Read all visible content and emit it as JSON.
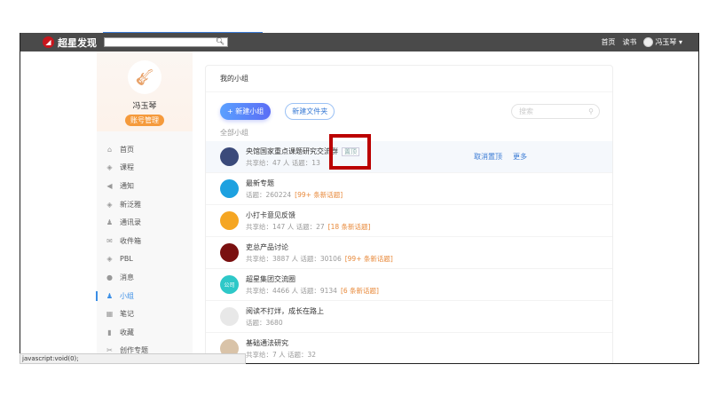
{
  "header": {
    "brand": "超星发现",
    "nav": [
      "首页",
      "读书"
    ],
    "user": "冯玉琴"
  },
  "profile": {
    "name": "冯玉琴",
    "account_button": "账号管理"
  },
  "sidebar": {
    "items": [
      {
        "label": "首页",
        "icon": "⌂"
      },
      {
        "label": "课程",
        "icon": "◈"
      },
      {
        "label": "通知",
        "icon": "◀"
      },
      {
        "label": "新泛雅",
        "icon": "◈"
      },
      {
        "label": "通讯录",
        "icon": "♟"
      },
      {
        "label": "收件箱",
        "icon": "✉"
      },
      {
        "label": "PBL",
        "icon": "◈"
      },
      {
        "label": "消息",
        "icon": "●"
      },
      {
        "label": "小组",
        "icon": "♟"
      },
      {
        "label": "笔记",
        "icon": "▦"
      },
      {
        "label": "收藏",
        "icon": "▮"
      },
      {
        "label": "创作专题",
        "icon": "✂"
      }
    ],
    "active": 8
  },
  "main": {
    "title": "我的小组",
    "new_group": "+ 新建小组",
    "new_folder": "新建文件夹",
    "search_placeholder": "搜索",
    "section": "全部小组",
    "groups": [
      {
        "name": "央馆国家重点课题研究交流群",
        "meta": "共享给：47 人 话题：13",
        "new": "",
        "pin": "置顶",
        "actions": [
          "取消置顶",
          "更多"
        ],
        "color": "#3b4a7a"
      },
      {
        "name": "最新专题",
        "meta": "话题：260224",
        "new": "[99+ 条新话题]",
        "color": "#1da1e0"
      },
      {
        "name": "小打卡意见反馈",
        "meta": "共享给：147 人 话题：27",
        "new": "[18 条新话题]",
        "color": "#f5a623"
      },
      {
        "name": "吏总产品讨论",
        "meta": "共享给：3887 人 话题：30106",
        "new": "[99+ 条新话题]",
        "color": "#7a1010"
      },
      {
        "name": "超星集团交流圈",
        "meta": "共享给：4466 人 话题：9134",
        "new": "[6 条新话题]",
        "color": "#2ec8c8",
        "avatar_text": "公司"
      },
      {
        "name": "阅读不打烊，成长在路上",
        "meta": "话题：3680",
        "new": "",
        "color": "#e8e8e8"
      },
      {
        "name": "基础通法研究",
        "meta": "共享给：7 人 话题：32",
        "new": "",
        "color": "#d9c3a8"
      }
    ]
  },
  "statusbar": "javascript:void(0);"
}
